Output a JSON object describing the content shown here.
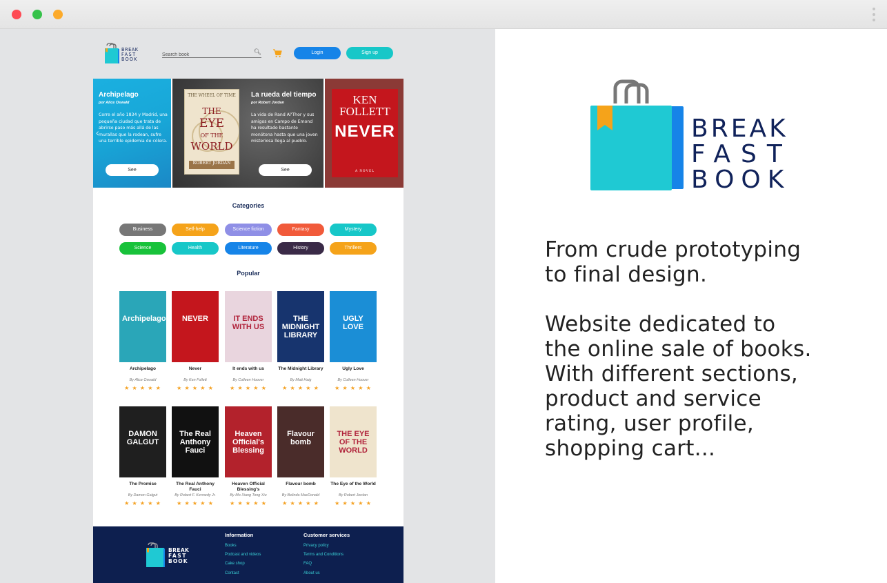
{
  "header": {
    "logo_words": [
      "BREAK",
      "FAST",
      "BOOK"
    ],
    "search_placeholder": "Search book",
    "login_label": "Login",
    "signup_label": "Sign up"
  },
  "hero": {
    "slides": [
      {
        "title": "Archipelago",
        "author": "por Alice Oswald",
        "description": "Corre el año 1834 y Madrid, una pequeña ciudad que trata de abrirse paso más allá de las murallas que la rodean, sufre una terrible epidemia de cólera.",
        "button": "See"
      },
      {
        "title": "La rueda del tiempo",
        "author": "por Robert Jordan",
        "description": "La vida de Rand Al'Thor y sus amigos en Campo de Emond ha resultado bastante monótona hasta que una joven misteriosa llega al pueblo.",
        "button": "See"
      }
    ],
    "cover_eye": {
      "series": "THE WHEEL OF TIME",
      "word1": "THE",
      "word2": "EYE",
      "word3": "OF THE",
      "word4": "WORLD",
      "author": "ROBERT JORDAN"
    },
    "cover_never": {
      "author_line1": "KEN",
      "author_line2": "FOLLETT",
      "title": "NEVER",
      "tagline": "A NOVEL"
    }
  },
  "categories": {
    "title": "Categories",
    "items": [
      {
        "label": "Business",
        "color": "#777777"
      },
      {
        "label": "Self-help",
        "color": "#f5a31a"
      },
      {
        "label": "Science fiction",
        "color": "#8f8fe6"
      },
      {
        "label": "Fantasy",
        "color": "#f15a3a"
      },
      {
        "label": "Mystery",
        "color": "#17c7c8"
      },
      {
        "label": "Science",
        "color": "#18c23a"
      },
      {
        "label": "Health",
        "color": "#17c7c8"
      },
      {
        "label": "Literature",
        "color": "#1684e8"
      },
      {
        "label": "History",
        "color": "#3a2a47"
      },
      {
        "label": "Thrillers",
        "color": "#f5a31a"
      }
    ]
  },
  "popular": {
    "title": "Popular",
    "stars": "★ ★ ★ ★ ★",
    "books": [
      {
        "title": "Archipelago",
        "author": "By Alice Oswald",
        "cover_text": "Archipelago",
        "cover_color": "#2aa6b8"
      },
      {
        "title": "Never",
        "author": "By Ken Follett",
        "cover_text": "NEVER",
        "cover_color": "#c4161d"
      },
      {
        "title": "It ends with us",
        "author": "By Colleen Hoover",
        "cover_text": "IT ENDS WITH US",
        "cover_color": "#e9d5de"
      },
      {
        "title": "The Midnight Library",
        "author": "By Matt Haig",
        "cover_text": "THE MIDNIGHT LIBRARY",
        "cover_color": "#17346e"
      },
      {
        "title": "Ugly Love",
        "author": "By Colleen Hoover",
        "cover_text": "UGLY LOVE",
        "cover_color": "#1b8ed6"
      },
      {
        "title": "The Promise",
        "author": "By Damon Galgut",
        "cover_text": "DAMON GALGUT",
        "cover_color": "#1f1f1f"
      },
      {
        "title": "The Real Anthony Fauci",
        "author": "By Robert F. Kennedy Jr.",
        "cover_text": "The Real Anthony Fauci",
        "cover_color": "#111111"
      },
      {
        "title": "Heaven Official Blessing's",
        "author": "By Mo Xiang Tong Xiu",
        "cover_text": "Heaven Official's Blessing",
        "cover_color": "#b3222c"
      },
      {
        "title": "Flavour bomb",
        "author": "By Belinda MacDonald",
        "cover_text": "Flavour bomb",
        "cover_color": "#4a2c2a"
      },
      {
        "title": "The Eye of the World",
        "author": "By Robert Jordan",
        "cover_text": "THE EYE OF THE WORLD",
        "cover_color": "#efe4cd"
      }
    ]
  },
  "footer": {
    "info_title": "Information",
    "info_links": [
      "Books",
      "Podcast and videos",
      "Cake shop",
      "Contact"
    ],
    "service_title": "Customer services",
    "service_links": [
      "Privacy policy",
      "Terms and Conditions",
      "FAQ",
      "About us"
    ]
  },
  "right_panel": {
    "paragraph1": "From crude prototyping\nto final design.",
    "paragraph2": "Website dedicated to\nthe online sale of books.\nWith different sections,\nproduct and service\nrating, user profile,\nshopping cart..."
  }
}
